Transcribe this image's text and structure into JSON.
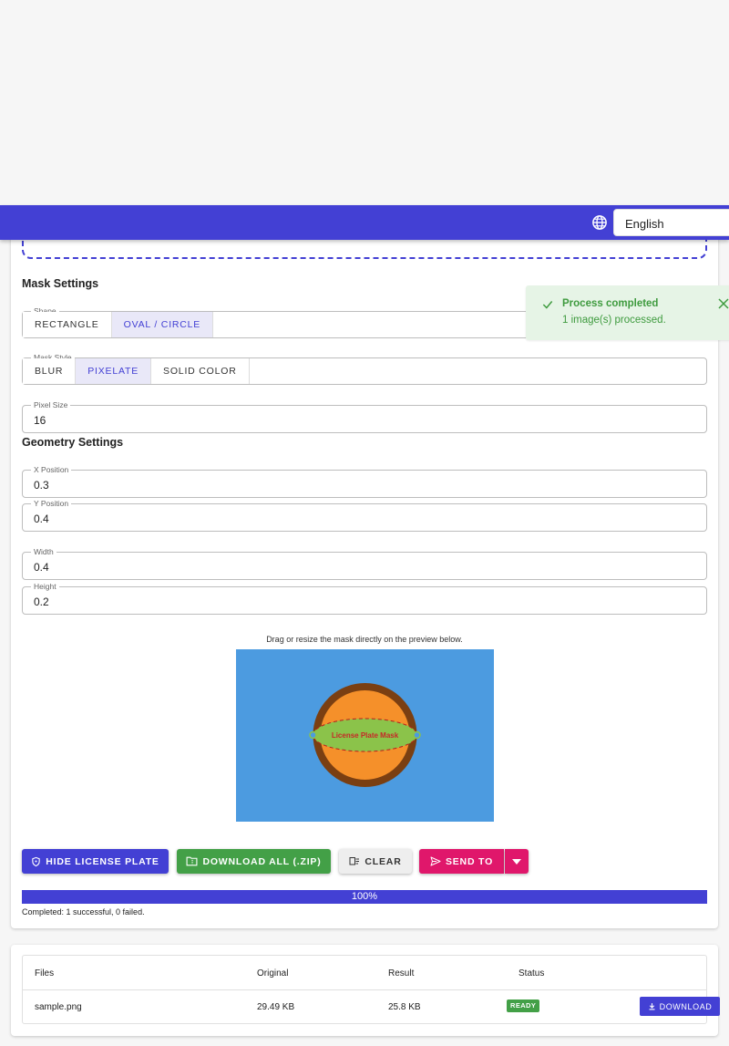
{
  "header": {
    "language": "English"
  },
  "mask_settings": {
    "title": "Mask Settings",
    "shape": {
      "legend": "Shape",
      "options": [
        "RECTANGLE",
        "OVAL / CIRCLE"
      ],
      "selected": "OVAL / CIRCLE"
    },
    "mask_style": {
      "legend": "Mask Style",
      "options": [
        "BLUR",
        "PIXELATE",
        "SOLID COLOR"
      ],
      "selected": "PIXELATE"
    },
    "pixel_size": {
      "legend": "Pixel Size",
      "value": "16"
    }
  },
  "geometry_settings": {
    "title": "Geometry Settings",
    "x_position": {
      "legend": "X Position",
      "value": "0.3"
    },
    "y_position": {
      "legend": "Y Position",
      "value": "0.4"
    },
    "width": {
      "legend": "Width",
      "value": "0.4"
    },
    "height": {
      "legend": "Height",
      "value": "0.2"
    }
  },
  "preview": {
    "hint": "Drag or resize the mask directly on the preview below.",
    "mask_label": "License Plate Mask"
  },
  "actions": {
    "hide": "HIDE LICENSE PLATE",
    "download_all": "DOWNLOAD ALL (.ZIP)",
    "clear": "CLEAR",
    "send_to": "SEND TO"
  },
  "progress": {
    "value": 100,
    "label": "100%",
    "status": "Completed: 1 successful, 0 failed."
  },
  "toast": {
    "title": "Process completed",
    "message": "1 image(s) processed."
  },
  "files_table": {
    "headers": [
      "Files",
      "Original",
      "Result",
      "Status"
    ],
    "rows": [
      {
        "file": "sample.png",
        "original": "29.49 KB",
        "result": "25.8 KB",
        "status": "READY",
        "action": "DOWNLOAD"
      }
    ]
  },
  "colors": {
    "primary": "#4340d4",
    "success": "#43a047",
    "pink": "#e0176b",
    "preview_bg": "#4c9be0",
    "orange": "#f5902a",
    "brown": "#7a3f12"
  }
}
